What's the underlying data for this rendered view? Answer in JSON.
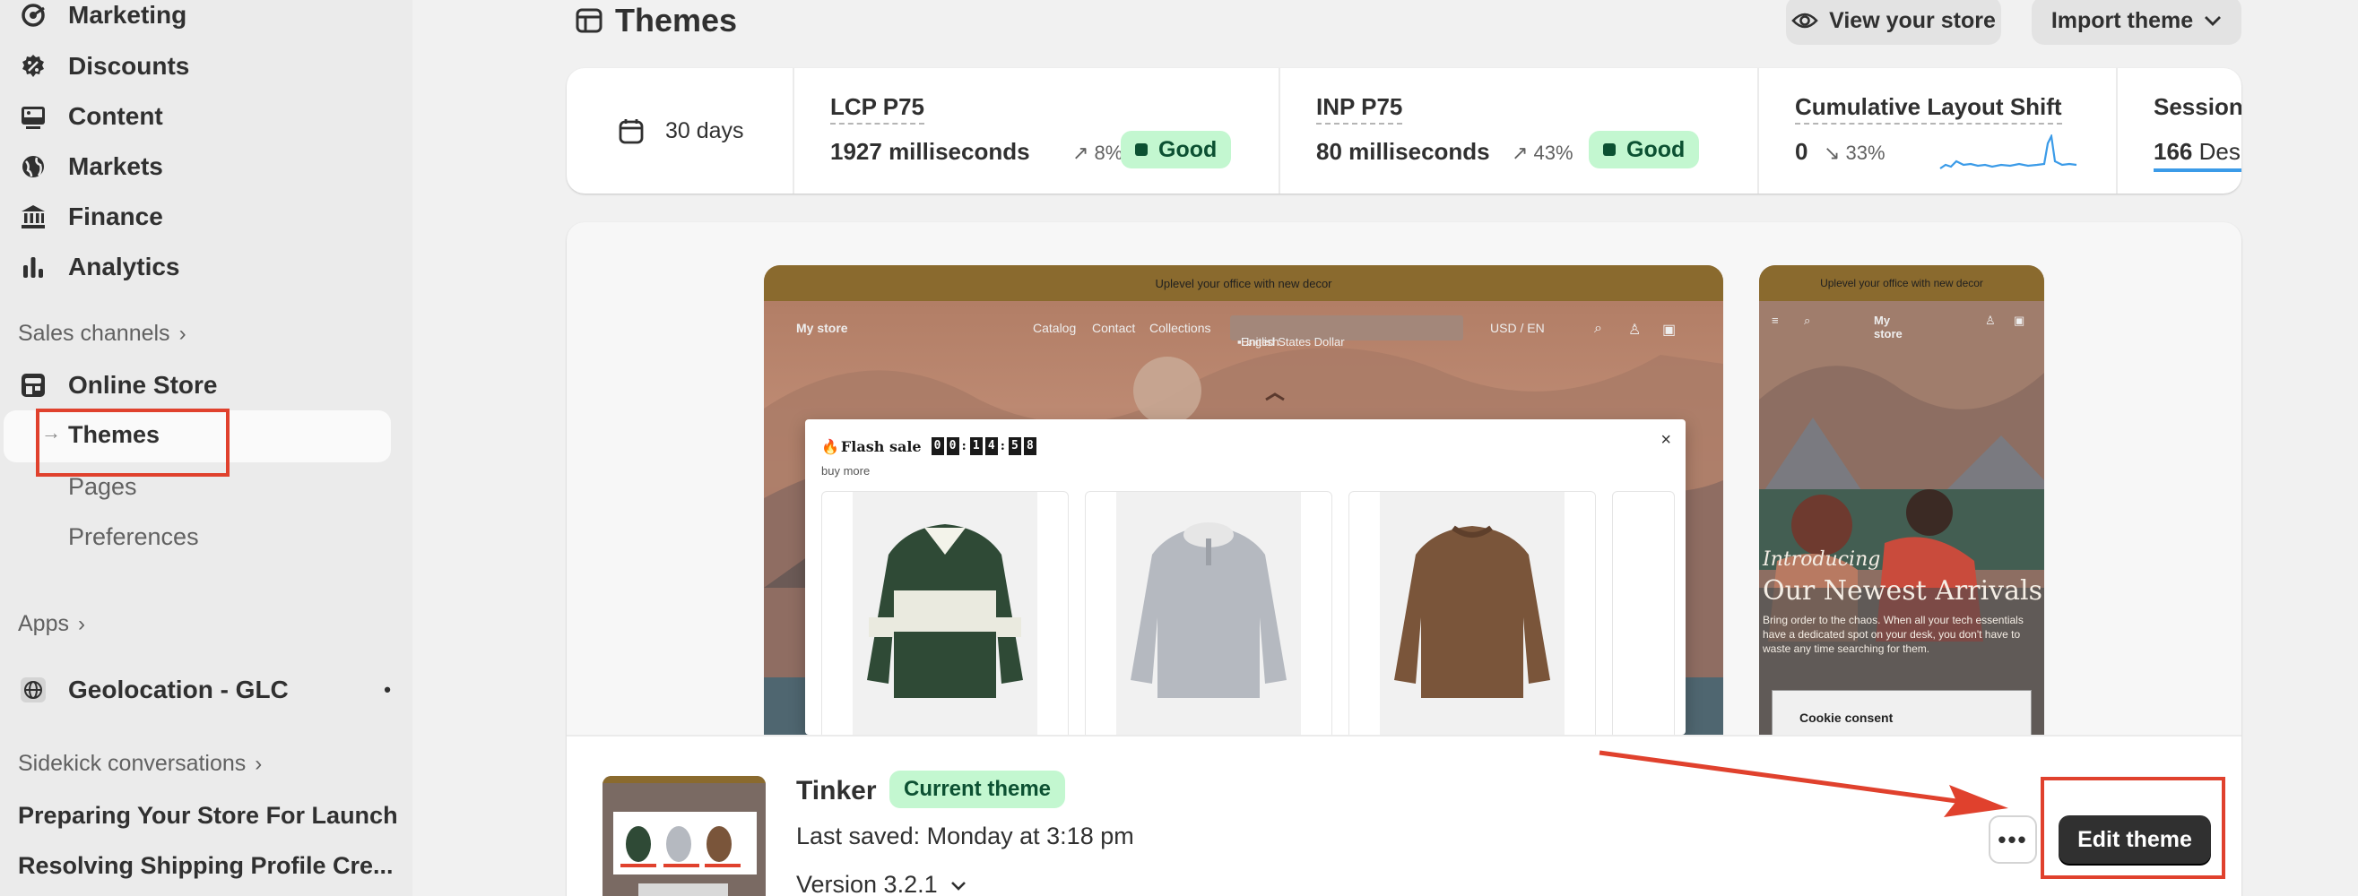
{
  "sidebar": {
    "nav": [
      {
        "label": "Marketing",
        "icon": "marketing-icon"
      },
      {
        "label": "Discounts",
        "icon": "discount-icon"
      },
      {
        "label": "Content",
        "icon": "content-icon"
      },
      {
        "label": "Markets",
        "icon": "globe-icon"
      },
      {
        "label": "Finance",
        "icon": "bank-icon"
      },
      {
        "label": "Analytics",
        "icon": "bar-chart-icon"
      }
    ],
    "sales_channels": "Sales channels",
    "online_store": "Online Store",
    "sub_items": {
      "themes": "Themes",
      "pages": "Pages",
      "preferences": "Preferences"
    },
    "apps": "Apps",
    "app_item": "Geolocation - GLC",
    "sidekick": "Sidekick conversations",
    "conversations": [
      "Preparing Your Store For Launch",
      "Resolving Shipping Profile Cre..."
    ]
  },
  "header": {
    "title": "Themes",
    "view_store": "View your store",
    "import_theme": "Import theme"
  },
  "metrics": {
    "period": "30 days",
    "lcp": {
      "title": "LCP P75",
      "value": "1927 milliseconds",
      "delta": "8%",
      "status": "Good"
    },
    "inp": {
      "title": "INP P75",
      "value": "80 milliseconds",
      "delta": "43%",
      "status": "Good"
    },
    "cls": {
      "title": "Cumulative Layout Shift",
      "value": "0",
      "delta": "33%"
    },
    "sessions": {
      "title": "Session",
      "value": "166",
      "suffix": "Des"
    }
  },
  "preview": {
    "announcement": "Uplevel your office with new decor",
    "store_name": "My store",
    "nav_links": [
      "Catalog",
      "Contact",
      "Collections"
    ],
    "language": "English",
    "currency": "United States Dollar",
    "locale": "USD / EN",
    "flash_sale": "Flash sale",
    "timer": [
      "0",
      "0",
      "1",
      "4",
      "5",
      "8"
    ],
    "buy_more": "buy more",
    "mobile_intro": "Introducing",
    "mobile_heading": "Our Newest Arrivals",
    "mobile_desc": "Bring order to the chaos. When all your tech essentials have a dedicated spot on your desk, you don't have to waste any time searching for them.",
    "cookie": "Cookie consent"
  },
  "theme": {
    "name": "Tinker",
    "badge": "Current theme",
    "last_saved": "Last saved: Monday at 3:18 pm",
    "version": "Version 3.2.1",
    "more": "•••",
    "edit": "Edit theme"
  },
  "colors": {
    "annotation": "#e0412d",
    "good_badge_bg": "#c3f7d0",
    "good_badge_fg": "#0c5132",
    "primary_button": "#303030"
  }
}
